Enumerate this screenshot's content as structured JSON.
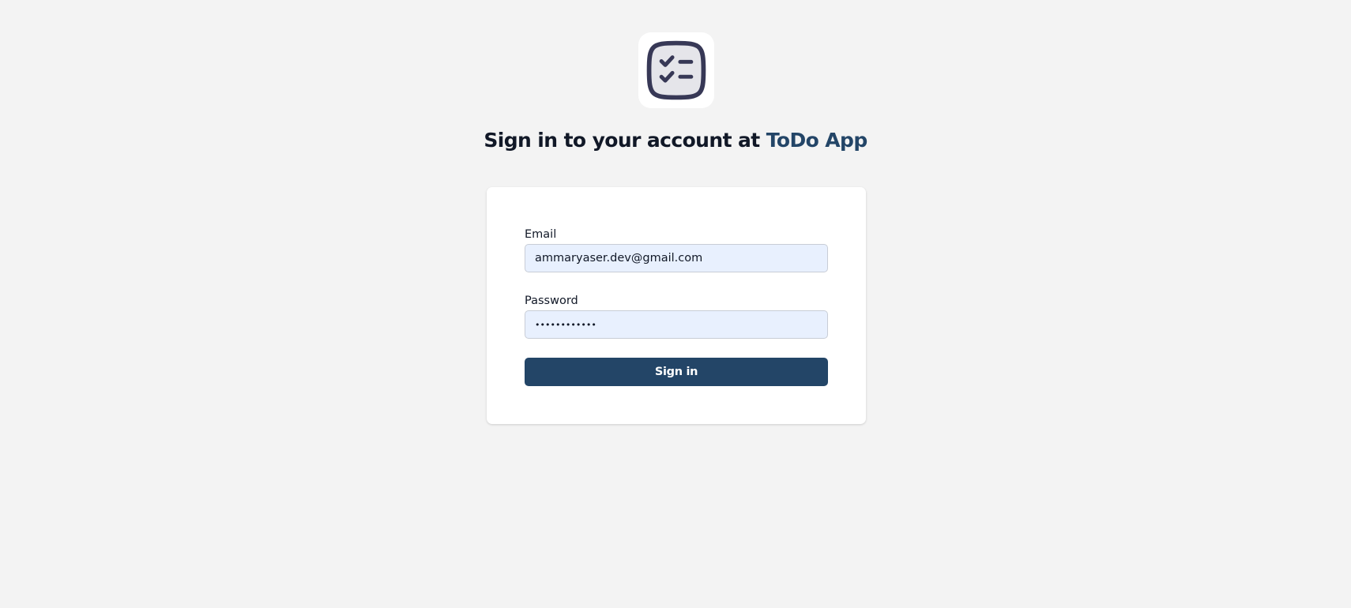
{
  "logo": {
    "icon": "checklist-icon",
    "fill_color": "#e5e5ea",
    "stroke_color": "#373856"
  },
  "header": {
    "title_prefix": "Sign in to your account at ",
    "app_name": "ToDo App",
    "app_name_color": "#234567"
  },
  "form": {
    "email": {
      "label": "Email",
      "value": "ammaryaser.dev@gmail.com"
    },
    "password": {
      "label": "Password",
      "value": "••••••••••••"
    },
    "submit_label": "Sign in",
    "submit_color": "#234567"
  }
}
